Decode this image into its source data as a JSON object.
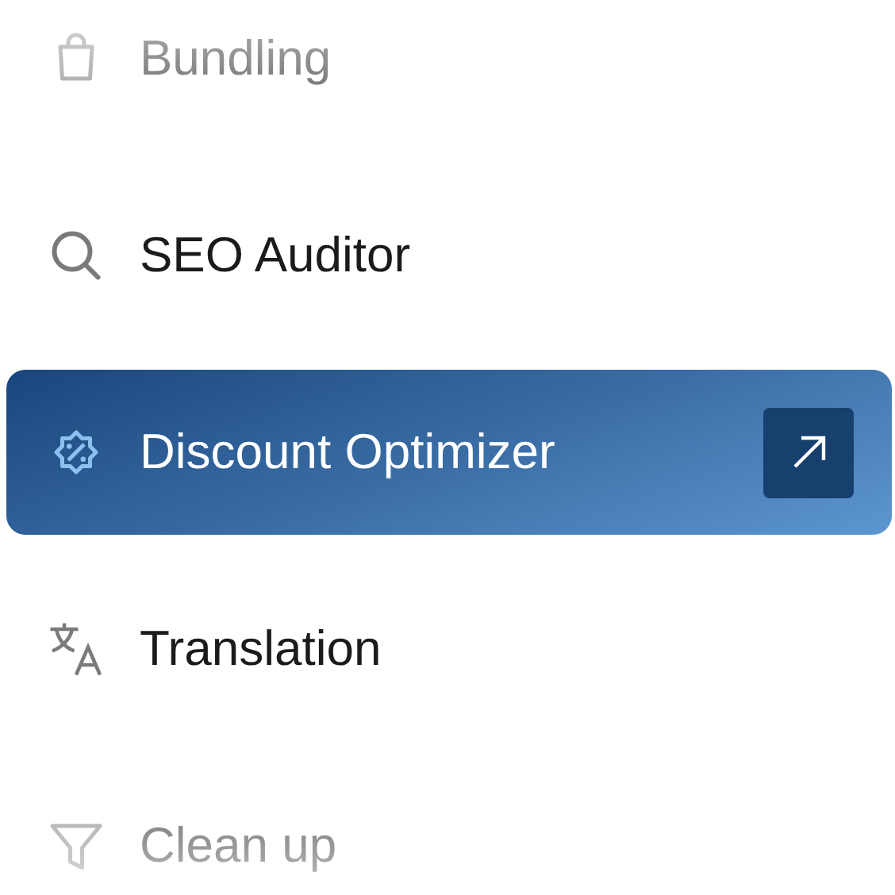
{
  "menu": {
    "items": [
      {
        "label": "Bundling",
        "kind": "bag",
        "selected": false
      },
      {
        "label": "SEO Auditor",
        "kind": "search",
        "selected": false
      },
      {
        "label": "Discount Optimizer",
        "kind": "discount",
        "selected": true
      },
      {
        "label": "Translation",
        "kind": "translate",
        "selected": false
      },
      {
        "label": "Clean up",
        "kind": "filter",
        "selected": false
      }
    ]
  }
}
